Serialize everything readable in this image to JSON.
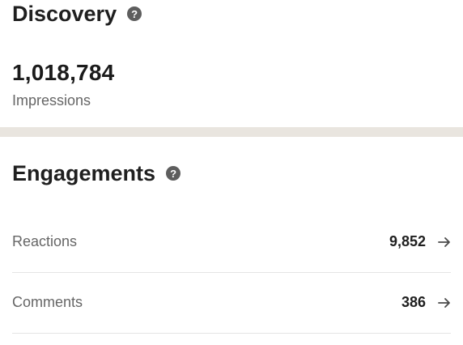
{
  "discovery": {
    "title": "Discovery",
    "help_icon": "help-icon",
    "impressions_value": "1,018,784",
    "impressions_label": "Impressions"
  },
  "engagements": {
    "title": "Engagements",
    "help_icon": "help-icon",
    "rows": [
      {
        "label": "Reactions",
        "value": "9,852",
        "icon": "arrow-right-icon"
      },
      {
        "label": "Comments",
        "value": "386",
        "icon": "arrow-right-icon"
      }
    ]
  },
  "colors": {
    "divider_band": "#e9e5df",
    "muted_text": "#666666",
    "primary_text": "#1f1f1f"
  }
}
